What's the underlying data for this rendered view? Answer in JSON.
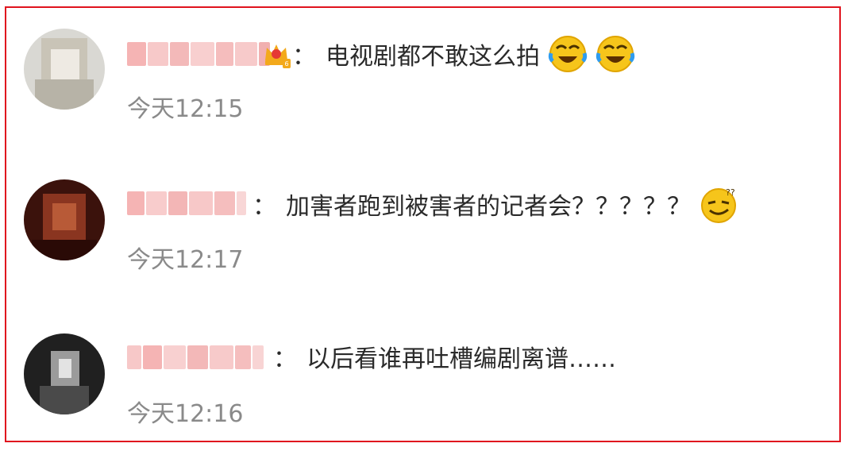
{
  "comments": [
    {
      "text": "电视剧都不敢这么拍",
      "time": "今天12:15",
      "badge": "crown-badge-icon",
      "emojis": [
        "laugh-cry-icon",
        "laugh-cry-icon"
      ]
    },
    {
      "text": "加害者跑到被害者的记者会？？？？？",
      "time": "今天12:17",
      "emojis": [
        "confused-smile-icon"
      ]
    },
    {
      "text": "以后看谁再吐槽编剧离谱……",
      "time": "今天12:16",
      "emojis": []
    }
  ],
  "separator": "：",
  "colors": {
    "border": "#e0141e",
    "text": "#2a2a2a",
    "time": "#8a8a8a",
    "name_blur": "#f4b6b6"
  }
}
